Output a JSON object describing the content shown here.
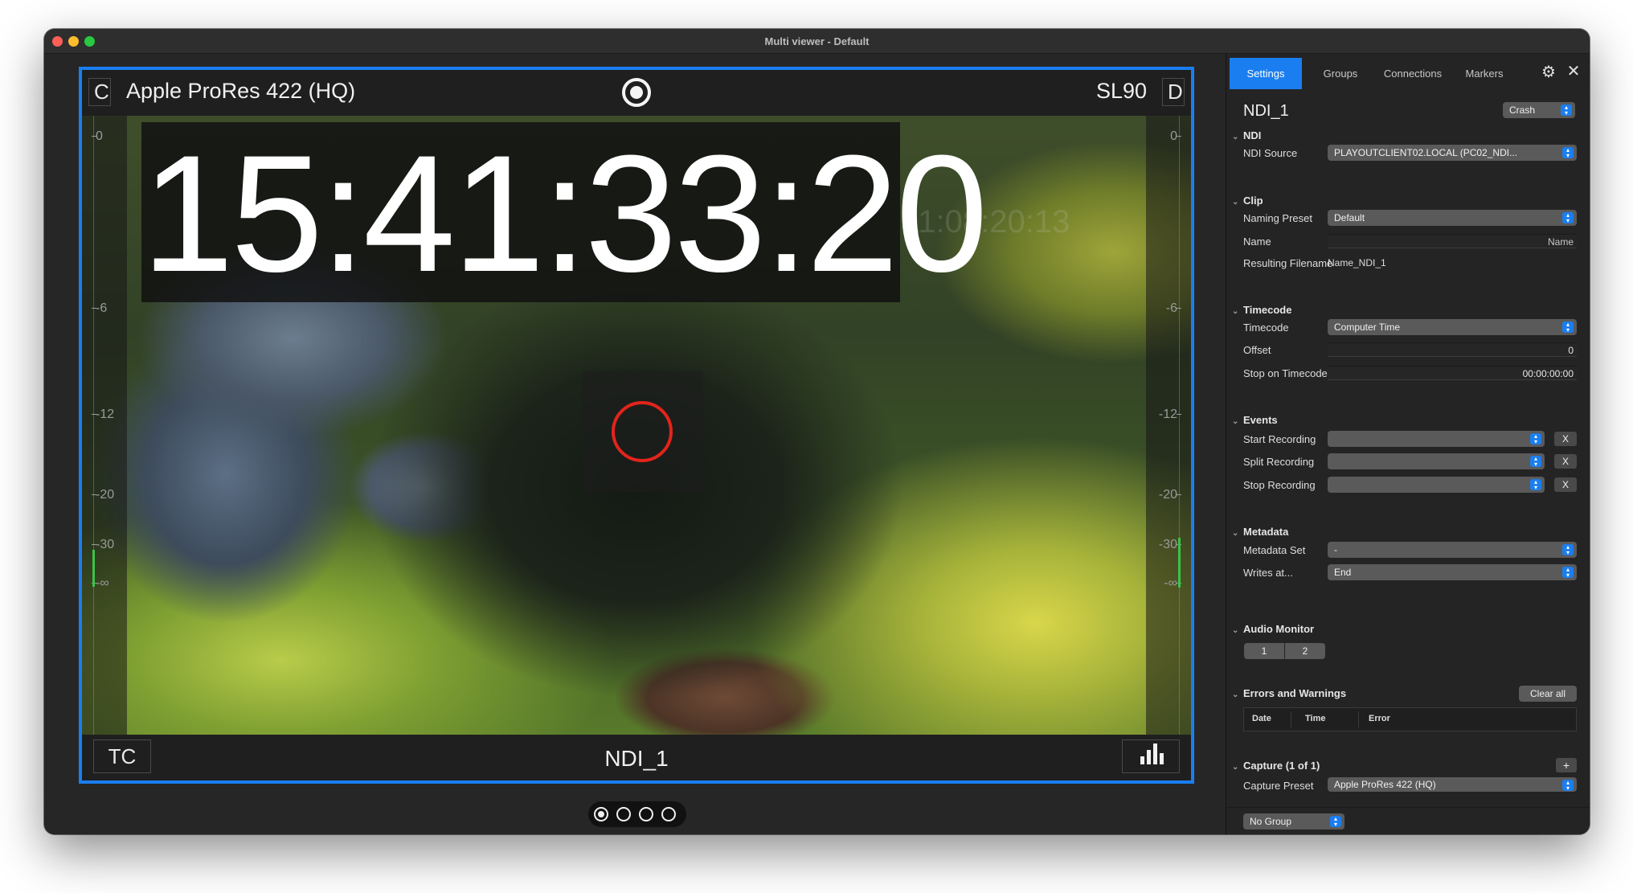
{
  "window": {
    "title": "Multi viewer - Default"
  },
  "viewer": {
    "left_badge": "C",
    "format": "Apple ProRes 422 (HQ)",
    "standard": "SL90",
    "right_badge": "D",
    "timecode": "15:41:33:20",
    "burned_timecode": "11:08:20:13",
    "meter_scale": [
      "0",
      "-6",
      "-12",
      "-20",
      "-30",
      "-∞"
    ],
    "tc_button": "TC",
    "source_name": "NDI_1",
    "accent_color": "#1a7ef0",
    "focus_color": "#e2241b"
  },
  "pager": {
    "pages": 4,
    "active": 0
  },
  "panel": {
    "tabs": [
      "Settings",
      "Groups",
      "Connections",
      "Markers"
    ],
    "active_tab": 0,
    "title": "NDI_1",
    "mode": "Crash",
    "ndi": {
      "header": "NDI",
      "source_label": "NDI Source",
      "source_value": "PLAYOUTCLIENT02.LOCAL (PC02_NDI..."
    },
    "clip": {
      "header": "Clip",
      "naming_preset_label": "Naming Preset",
      "naming_preset_value": "Default",
      "name_label": "Name",
      "name_value": "Name",
      "resulting_label": "Resulting Filename",
      "resulting_value": "Name_NDI_1"
    },
    "timecode": {
      "header": "Timecode",
      "tc_label": "Timecode",
      "tc_value": "Computer Time",
      "offset_label": "Offset",
      "offset_value": "0",
      "stop_label": "Stop on Timecode",
      "stop_value": "00:00:00:00"
    },
    "events": {
      "header": "Events",
      "start_label": "Start Recording",
      "split_label": "Split Recording",
      "stop_label": "Stop Recording",
      "clear_label": "X"
    },
    "metadata": {
      "header": "Metadata",
      "set_label": "Metadata Set",
      "set_value": "-",
      "writes_label": "Writes at...",
      "writes_value": "End"
    },
    "audio_monitor": {
      "header": "Audio Monitor",
      "channels": [
        "1",
        "2"
      ]
    },
    "errors": {
      "header": "Errors and Warnings",
      "clear_all": "Clear all",
      "columns": [
        "Date",
        "Time",
        "Error"
      ]
    },
    "capture": {
      "header": "Capture (1 of 1)",
      "add": "+",
      "preset_label": "Capture Preset",
      "preset_value": "Apple ProRes 422 (HQ)"
    },
    "group": "No Group"
  }
}
